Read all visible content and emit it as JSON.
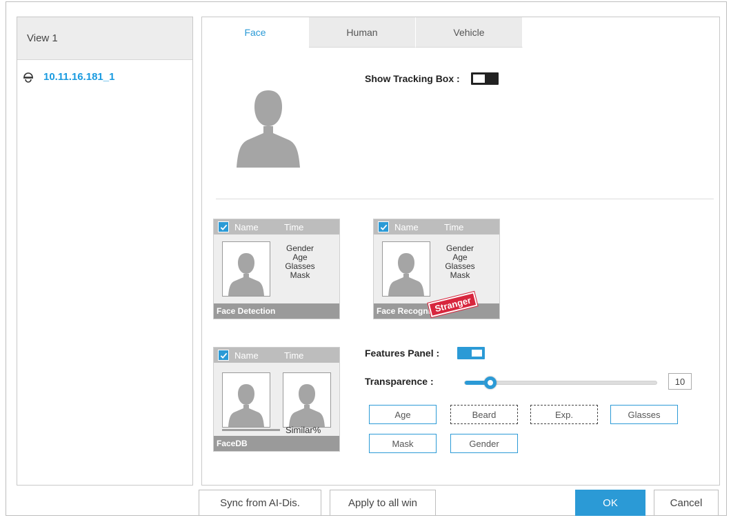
{
  "left_panel": {
    "header": "View 1",
    "tree_item": "10.11.16.181_1"
  },
  "tabs": [
    "Face",
    "Human",
    "Vehicle"
  ],
  "active_tab": "Face",
  "show_tracking_box": {
    "label": "Show Tracking Box :",
    "enabled": false
  },
  "cards": {
    "face_detection": {
      "head_name": "Name",
      "head_time": "Time",
      "attrs": [
        "Gender",
        "Age",
        "Glasses",
        "Mask"
      ],
      "footer": "Face Detection"
    },
    "face_recognition": {
      "head_name": "Name",
      "head_time": "Time",
      "attrs": [
        "Gender",
        "Age",
        "Glasses",
        "Mask"
      ],
      "footer": "Face Recognition",
      "stamp": "Stranger"
    },
    "facedb": {
      "head_name": "Name",
      "head_time": "Time",
      "similar": "Similar%",
      "footer": "FaceDB"
    }
  },
  "features_panel": {
    "label": "Features Panel :",
    "enabled": true
  },
  "transparence": {
    "label": "Transparence :",
    "value": 10,
    "max": 100,
    "display": "10"
  },
  "feature_buttons": {
    "age": "Age",
    "beard": "Beard",
    "exp": "Exp.",
    "glasses": "Glasses",
    "mask": "Mask",
    "gender": "Gender"
  },
  "footer_buttons": {
    "sync": "Sync from AI-Dis.",
    "apply": "Apply to all win",
    "ok": "OK",
    "cancel": "Cancel"
  },
  "colors": {
    "accent": "#2b9ad6",
    "stamp": "#d7263d"
  }
}
